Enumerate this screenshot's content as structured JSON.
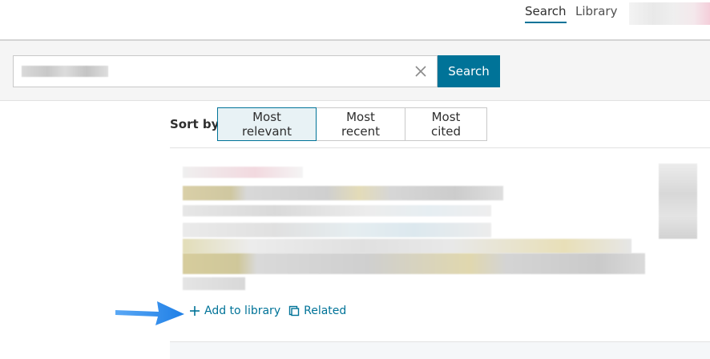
{
  "topnav": {
    "search_label": "Search",
    "library_label": "Library"
  },
  "search": {
    "value": "",
    "button_label": "Search",
    "clear_icon": "close-icon"
  },
  "sort": {
    "label": "Sort by",
    "options": [
      "Most relevant",
      "Most recent",
      "Most cited"
    ],
    "selected": "Most relevant"
  },
  "result": {
    "actions": {
      "add_label": "Add to library",
      "add_icon": "plus-icon",
      "related_label": "Related",
      "related_icon": "related-icon"
    }
  },
  "colors": {
    "accent": "#007398",
    "active_sort_bg": "#e8f2f5",
    "arrow": "#2f8ff0"
  }
}
